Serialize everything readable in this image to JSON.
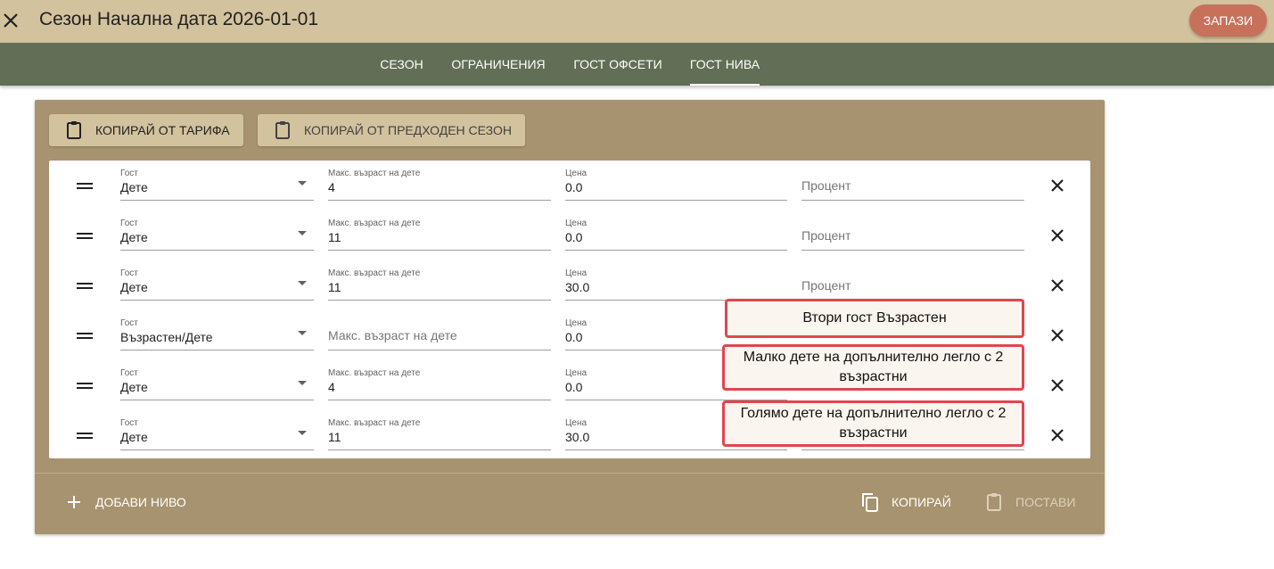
{
  "header": {
    "title": "Сезон Начална дата 2026-01-01",
    "save_label": "ЗАПАЗИ",
    "accent_color": "#c7715b"
  },
  "tabs": [
    {
      "label": "СЕЗОН",
      "active": false
    },
    {
      "label": "ОГРАНИЧЕНИЯ",
      "active": false
    },
    {
      "label": "ГОСТ ОФСЕТИ",
      "active": false
    },
    {
      "label": "ГОСТ НИВА",
      "active": true
    }
  ],
  "toolbar": {
    "copy_from_rate": "КОПИРАЙ ОТ ТАРИФА",
    "copy_from_prev_season": "КОПИРАЙ ОТ ПРЕДХОДЕН СЕЗОН"
  },
  "labels": {
    "guest": "Гост",
    "max_child_age": "Макс. възраст на дете",
    "price": "Цена",
    "percent": "Процент"
  },
  "rows": [
    {
      "guest": "Дете",
      "max_age": "4",
      "price": "0.0",
      "percent": ""
    },
    {
      "guest": "Дете",
      "max_age": "11",
      "price": "0.0",
      "percent": ""
    },
    {
      "guest": "Дете",
      "max_age": "11",
      "price": "30.0",
      "percent": ""
    },
    {
      "guest": "Възрастен/Дете",
      "max_age": "",
      "price": "0.0",
      "percent": ""
    },
    {
      "guest": "Дете",
      "max_age": "4",
      "price": "0.0",
      "percent": ""
    },
    {
      "guest": "Дете",
      "max_age": "11",
      "price": "30.0",
      "percent": ""
    }
  ],
  "callouts": [
    "Втори гост Възрастен",
    "Малко дете на допълнително легло с 2 възрастни",
    "Голямо дете на допълнително легло с 2 възрастни"
  ],
  "footer": {
    "add_level": "ДОБАВИ НИВО",
    "copy": "КОПИРАЙ",
    "paste": "ПОСТАВИ"
  },
  "icons": [
    "close-icon",
    "clipboard-icon",
    "drag-handle-icon",
    "dropdown-arrow-icon",
    "plus-icon",
    "copy-icon"
  ]
}
